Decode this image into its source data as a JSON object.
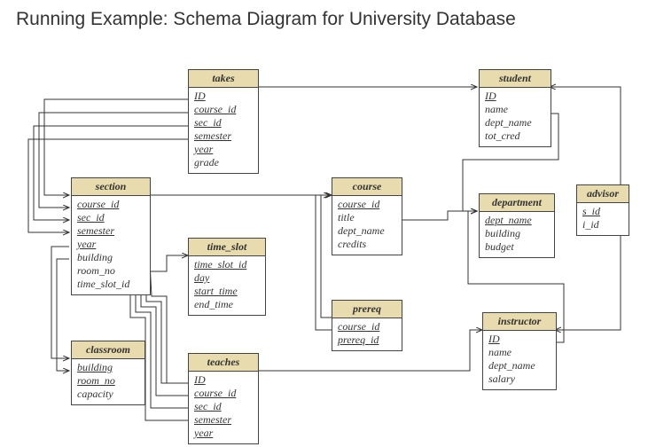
{
  "title": "Running Example: Schema Diagram for University Database",
  "entities": {
    "takes": {
      "name": "takes",
      "attrs": [
        "ID",
        "course_id",
        "sec_id",
        "semester",
        "year",
        "grade"
      ],
      "pk_count": 5
    },
    "student": {
      "name": "student",
      "attrs": [
        "ID",
        "name",
        "dept_name",
        "tot_cred"
      ],
      "pk_count": 1
    },
    "section": {
      "name": "section",
      "attrs": [
        "course_id",
        "sec_id",
        "semester",
        "year",
        "building",
        "room_no",
        "time_slot_id"
      ],
      "pk_count": 4
    },
    "time_slot": {
      "name": "time_slot",
      "attrs": [
        "time_slot_id",
        "day",
        "start_time",
        "end_time"
      ],
      "pk_count": 3
    },
    "course": {
      "name": "course",
      "attrs": [
        "course_id",
        "title",
        "dept_name",
        "credits"
      ],
      "pk_count": 1
    },
    "department": {
      "name": "department",
      "attrs": [
        "dept_name",
        "building",
        "budget"
      ],
      "pk_count": 1
    },
    "advisor": {
      "name": "advisor",
      "attrs": [
        "s_id",
        "i_id"
      ],
      "pk_count": 1
    },
    "classroom": {
      "name": "classroom",
      "attrs": [
        "building",
        "room_no",
        "capacity"
      ],
      "pk_count": 2
    },
    "prereq": {
      "name": "prereq",
      "attrs": [
        "course_id",
        "prereq_id"
      ],
      "pk_count": 2
    },
    "instructor": {
      "name": "instructor",
      "attrs": [
        "ID",
        "name",
        "dept_name",
        "salary"
      ],
      "pk_count": 1
    },
    "teaches": {
      "name": "teaches",
      "attrs": [
        "ID",
        "course_id",
        "sec_id",
        "semester",
        "year"
      ],
      "pk_count": 5
    }
  }
}
